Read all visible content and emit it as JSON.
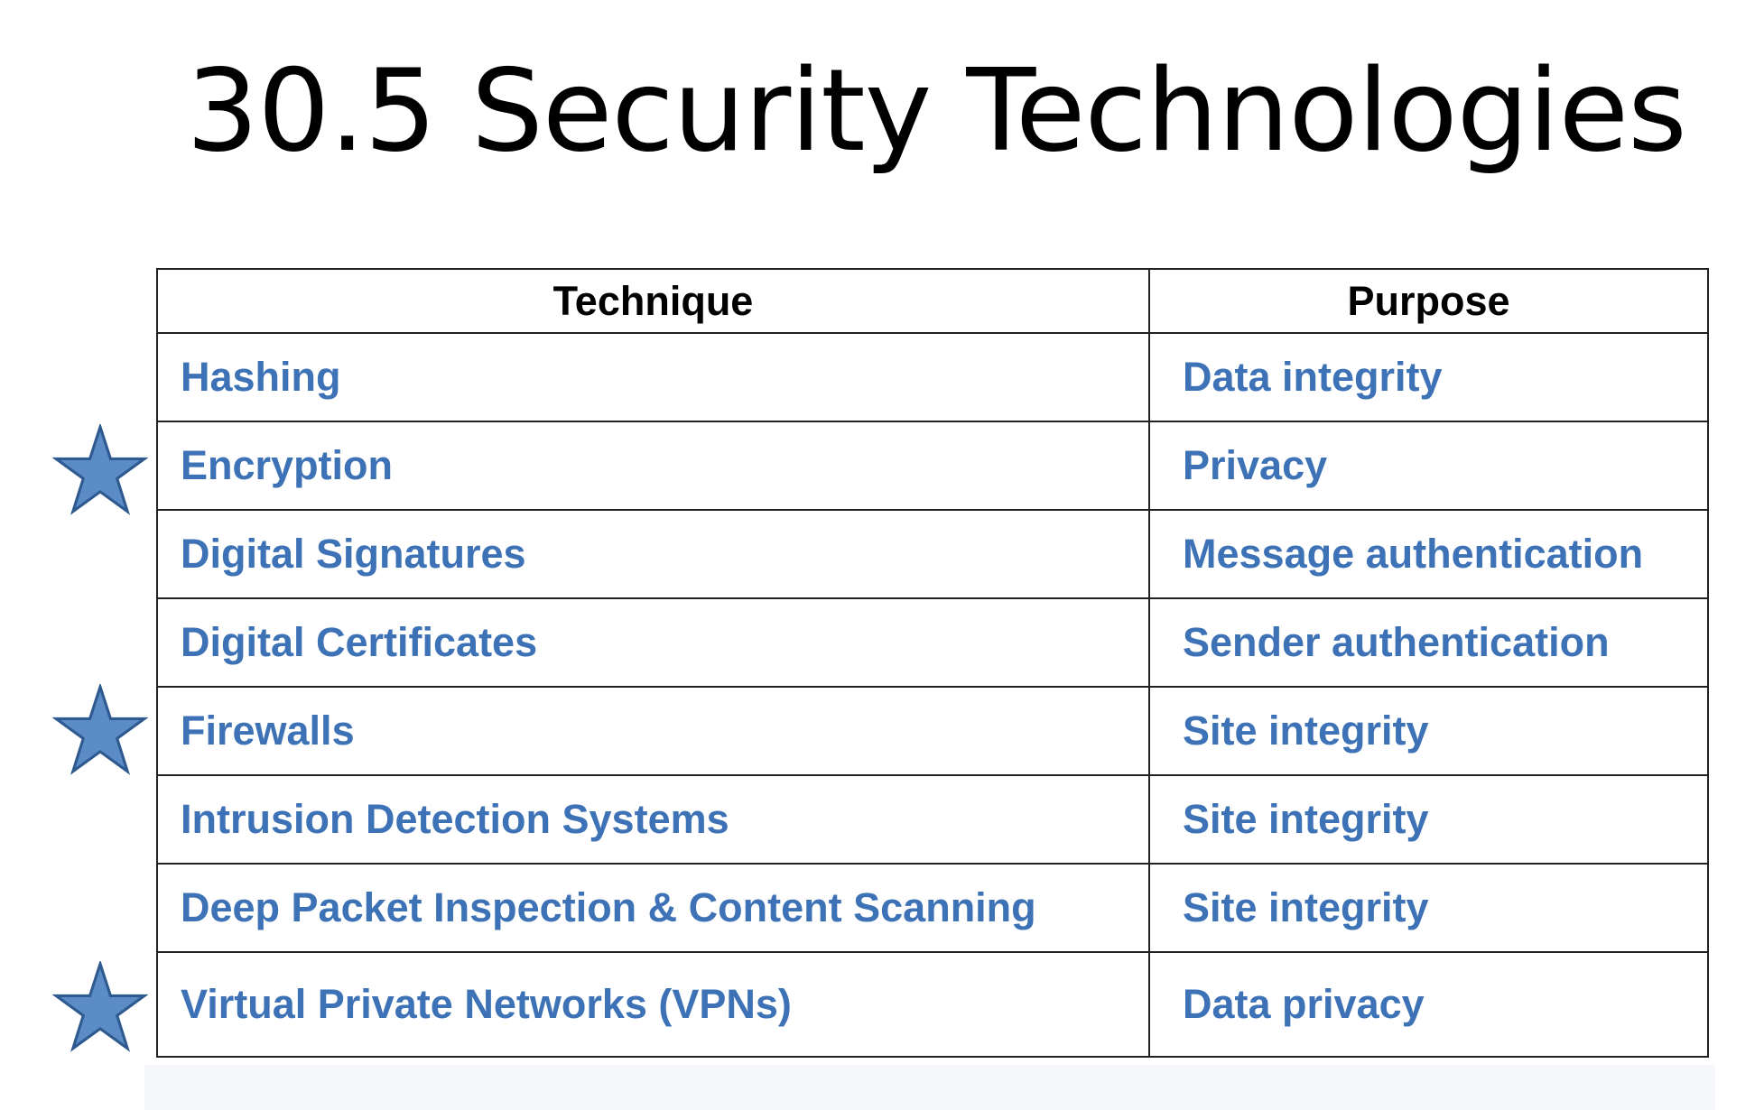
{
  "title": "30.5  Security Technologies",
  "table": {
    "headers": {
      "technique": "Technique",
      "purpose": "Purpose"
    },
    "rows": [
      {
        "technique": "Hashing",
        "purpose": "Data integrity",
        "starred": false
      },
      {
        "technique": "Encryption",
        "purpose": "Privacy",
        "starred": true
      },
      {
        "technique": "Digital Signatures",
        "purpose": "Message authentication",
        "starred": false
      },
      {
        "technique": "Digital Certificates",
        "purpose": "Sender authentication",
        "starred": false
      },
      {
        "technique": "Firewalls",
        "purpose": "Site integrity",
        "starred": true
      },
      {
        "technique": "Intrusion Detection Systems",
        "purpose": "Site integrity",
        "starred": false
      },
      {
        "technique": "Deep Packet Inspection & Content Scanning",
        "purpose": "Site integrity",
        "starred": false
      },
      {
        "technique": "Virtual Private Networks (VPNs)",
        "purpose": "Data privacy",
        "starred": true
      }
    ]
  },
  "colors": {
    "row_text": "#3d72b6",
    "header_text": "#000000",
    "star_fill": "#5b8cc6",
    "star_stroke": "#2f5a8f"
  },
  "icons": {
    "highlight_marker": "star-icon"
  }
}
